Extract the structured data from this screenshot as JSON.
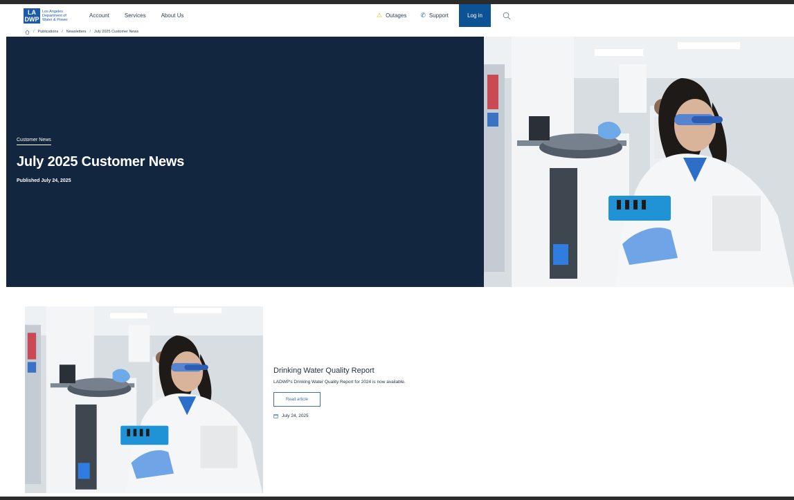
{
  "header": {
    "logo": {
      "mark_line1": "LA",
      "mark_line2": "DWP",
      "text": "Los Angeles Department of Water & Power"
    },
    "nav": [
      "Account",
      "Services",
      "About Us"
    ],
    "outages_label": "Outages",
    "support_label": "Support",
    "login_label": "Log in",
    "icons": {
      "outages": "warning-triangle-icon",
      "support": "phone-icon",
      "search": "search-icon"
    }
  },
  "breadcrumb": {
    "items": [
      "Publications",
      "Newsletters",
      "July 2025 Customer News"
    ],
    "separator": "/",
    "home_icon": "home-icon"
  },
  "hero": {
    "kicker": "Customer News",
    "title": "July 2025 Customer News",
    "published": "Published July 24, 2025",
    "image": "scientist-in-lab-photo"
  },
  "article_card": {
    "title": "Drinking Water Quality Report",
    "description": "LADWP's Drinking Water Quality Report for 2024 is now available.",
    "button_label": "Read article",
    "date": "July 24, 2025",
    "date_icon": "calendar-icon",
    "image": "scientist-in-lab-photo"
  },
  "colors": {
    "hero_background": "#12263f",
    "login_background": "#0b5394",
    "brand_blue": "#1c5aa8",
    "outage_warning": "#f2b200"
  }
}
